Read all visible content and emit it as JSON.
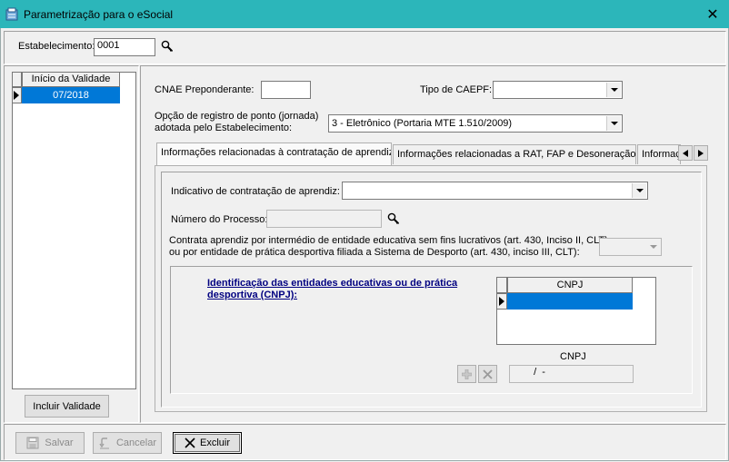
{
  "window": {
    "title": "Parametrização para o eSocial",
    "close_glyph": "✕"
  },
  "header": {
    "estabelecimento_label": "Estabelecimento:",
    "estabelecimento_value": "0001"
  },
  "validity": {
    "column_header": "Início da Validade",
    "rows": [
      "07/2018"
    ],
    "add_button": "Incluir Validade"
  },
  "form": {
    "cnae_label": "CNAE Preponderante:",
    "cnae_value": "",
    "tipo_caepf_label": "Tipo de CAEPF:",
    "tipo_caepf_value": "",
    "ponto_label_line1": "Opção de registro de ponto (jornada)",
    "ponto_label_line2": "adotada pelo Estabelecimento:",
    "ponto_value": "3 - Eletrônico (Portaria MTE 1.510/2009)"
  },
  "tabs": [
    {
      "label": "Informações relacionadas à contratação de aprendiz"
    },
    {
      "label": "Informações relacionadas a RAT, FAP e Desoneração"
    },
    {
      "label": "Informaç"
    }
  ],
  "aprendiz": {
    "indicativo_label": "Indicativo de contratação de aprendiz:",
    "indicativo_value": "",
    "processo_label": "Número do Processo:",
    "processo_value": "",
    "contrata_line1": "Contrata aprendiz por intermédio de entidade educativa sem fins lucrativos (art. 430, Inciso II, CLT)",
    "contrata_line2": "ou  por entidade de prática desportiva filiada a Sistema de Desporto (art. 430, inciso III, CLT):",
    "contrata_value": "",
    "entidades_title_line1": "Identificação das entidades educativas ou de prática",
    "entidades_title_line2": "desportiva (CNPJ):",
    "cnpj_column": "CNPJ",
    "cnpj_label": "CNPJ",
    "cnpj_mask": "  /  -"
  },
  "footer": {
    "save": "Salvar",
    "cancel": "Cancelar",
    "delete": "Excluir"
  }
}
